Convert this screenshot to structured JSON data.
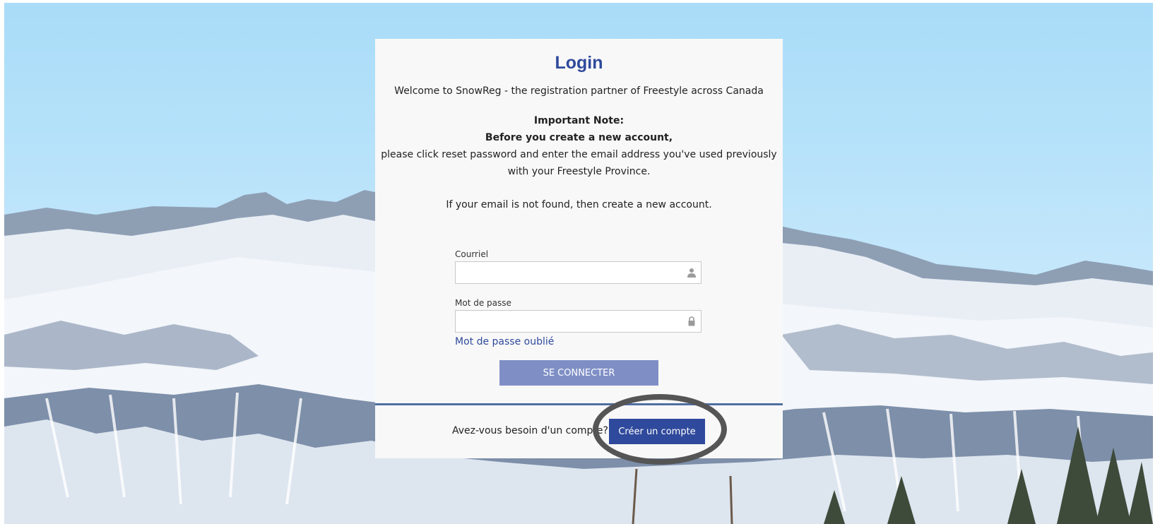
{
  "login": {
    "title": "Login",
    "welcome": "Welcome to SnowReg - the registration partner of Freestyle across Canada",
    "note_heading": "Important Note:",
    "note_bold": "Before you create a new account,",
    "note_line1": "please click reset password and enter the email address you've used previously",
    "note_line2": "with your Freestyle Province.",
    "note_line3": "If your email is not found, then create a new account.",
    "email": {
      "label": "Courriel",
      "value": "",
      "icon": "user-icon"
    },
    "password": {
      "label": "Mot de passe",
      "value": "",
      "icon": "lock-icon"
    },
    "forgot_link": "Mot de passe oublié",
    "submit_label": "SE CONNECTER",
    "account_question": "Avez-vous besoin d'un compte?",
    "create_label": "Créer un compte"
  },
  "colors": {
    "accent": "#2f4a9c",
    "login_button": "#7f8fc6",
    "card": "#f8f8f8"
  }
}
